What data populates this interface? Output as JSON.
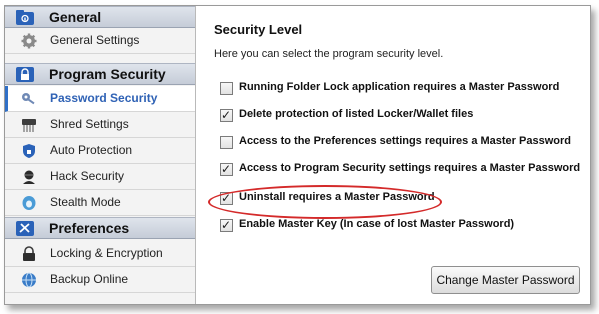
{
  "colors": {
    "accent": "#2f62b5",
    "highlight_ring": "#d42a2a",
    "section_header": "#cfd5df"
  },
  "sidebar": {
    "sections": [
      {
        "label": "General",
        "icon": "folder-lock-icon",
        "items": [
          {
            "label": "General Settings",
            "icon": "gear-icon",
            "active": false
          }
        ]
      },
      {
        "label": "Program Security",
        "icon": "padlock-icon",
        "items": [
          {
            "label": "Password Security",
            "icon": "key-icon",
            "active": true
          },
          {
            "label": "Shred Settings",
            "icon": "shredder-icon",
            "active": false
          },
          {
            "label": "Auto Protection",
            "icon": "shield-icon",
            "active": false
          },
          {
            "label": "Hack Security",
            "icon": "hacker-icon",
            "active": false
          },
          {
            "label": "Stealth Mode",
            "icon": "stealth-icon",
            "active": false
          }
        ]
      },
      {
        "label": "Preferences",
        "icon": "tools-icon",
        "items": [
          {
            "label": "Locking & Encryption",
            "icon": "lock-encryption-icon",
            "active": false
          },
          {
            "label": "Backup Online",
            "icon": "globe-icon",
            "active": false
          }
        ]
      }
    ]
  },
  "main": {
    "title": "Security Level",
    "description": "Here you can select the program security level.",
    "options": [
      {
        "label": "Running Folder Lock application requires a Master Password",
        "checked": false
      },
      {
        "label": "Delete protection of listed Locker/Wallet files",
        "checked": true
      },
      {
        "label": "Access to the Preferences settings requires a Master Password",
        "checked": false
      },
      {
        "label": "Access to Program Security settings requires a Master Password",
        "checked": true
      },
      {
        "label": "Uninstall requires a Master Password",
        "checked": true
      },
      {
        "label": "Enable Master Key (In case of lost Master Password)",
        "checked": true
      }
    ],
    "change_password_button": "Change Master Password",
    "check_glyph": "✓"
  }
}
